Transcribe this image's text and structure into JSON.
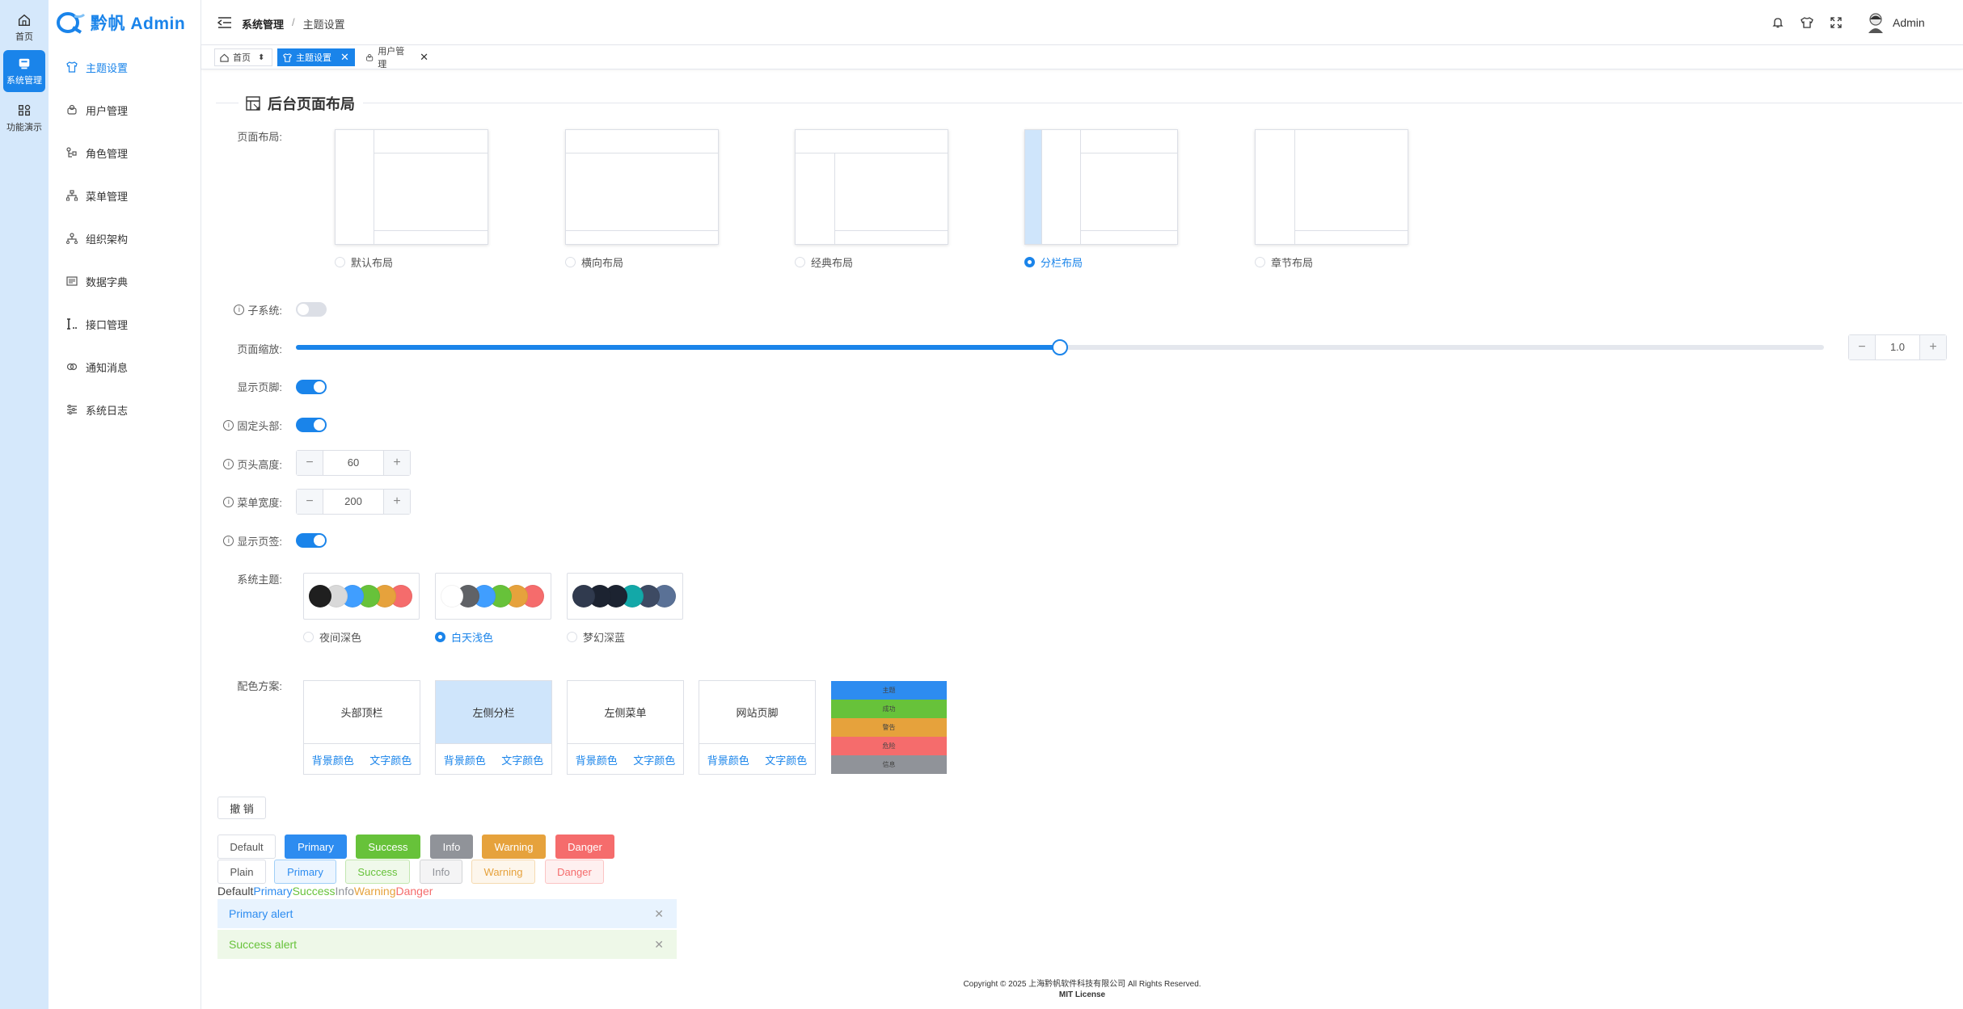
{
  "rail": {
    "items": [
      {
        "label": "首页",
        "icon": "home-icon"
      },
      {
        "label": "系统管理",
        "icon": "system-icon",
        "active": true
      },
      {
        "label": "功能演示",
        "icon": "grid-icon"
      }
    ]
  },
  "sidebar": {
    "logo": "黔帆 Admin",
    "items": [
      {
        "label": "主题设置",
        "icon": "shirt-icon",
        "active": true
      },
      {
        "label": "用户管理",
        "icon": "user-icon"
      },
      {
        "label": "角色管理",
        "icon": "role-icon"
      },
      {
        "label": "菜单管理",
        "icon": "menu-icon"
      },
      {
        "label": "组织架构",
        "icon": "org-icon"
      },
      {
        "label": "数据字典",
        "icon": "dict-icon"
      },
      {
        "label": "接口管理",
        "icon": "api-icon"
      },
      {
        "label": "通知消息",
        "icon": "notice-icon"
      },
      {
        "label": "系统日志",
        "icon": "log-icon"
      }
    ]
  },
  "header": {
    "breadcrumb": [
      "系统管理",
      "主题设置"
    ],
    "separator": "/",
    "user": "Admin"
  },
  "tabs": [
    {
      "label": "首页",
      "icon": "home-icon",
      "pinned": true
    },
    {
      "label": "主题设置",
      "icon": "shirt-icon",
      "active": true,
      "closable": true
    },
    {
      "label": "用户管理",
      "icon": "user-icon",
      "closable": true
    }
  ],
  "section": {
    "title": "后台页面布局"
  },
  "layout": {
    "label": "页面布局:",
    "options": [
      "默认布局",
      "横向布局",
      "经典布局",
      "分栏布局",
      "章节布局"
    ],
    "selected": 3
  },
  "settings": {
    "subsystem_label": "子系统:",
    "subsystem_on": false,
    "zoom_label": "页面缩放:",
    "zoom_value": "1.0",
    "zoom_fraction": 0.5,
    "footer_label": "显示页脚:",
    "footer_on": true,
    "fixed_header_label": "固定头部:",
    "fixed_header_on": true,
    "header_height_label": "页头高度:",
    "header_height": "60",
    "menu_width_label": "菜单宽度:",
    "menu_width": "200",
    "show_tabs_label": "显示页签:",
    "show_tabs_on": true
  },
  "theme": {
    "label": "系统主题:",
    "options": [
      {
        "name": "夜间深色",
        "colors": [
          "#1f1f1f",
          "#d9d9d9",
          "#409eff",
          "#67c23a",
          "#e6a23c",
          "#f56c6c"
        ]
      },
      {
        "name": "白天浅色",
        "colors": [
          "#ffffff",
          "#606266",
          "#409eff",
          "#67c23a",
          "#e6a23c",
          "#f56c6c"
        ],
        "selected": true
      },
      {
        "name": "梦幻深蓝",
        "colors": [
          "#303a4e",
          "#1c2331",
          "#1c2331",
          "#13a8a8",
          "#3d4a63",
          "#5a7196"
        ]
      }
    ]
  },
  "scheme": {
    "label": "配色方案:",
    "cards": [
      "头部顶栏",
      "左侧分栏",
      "左侧菜单",
      "网站页脚"
    ],
    "bg_color": "背景颜色",
    "text_color": "文字颜色",
    "palette": [
      {
        "label": "主题",
        "color": "#2d8cf0"
      },
      {
        "label": "成功",
        "color": "#67c23a"
      },
      {
        "label": "警告",
        "color": "#e6a23c"
      },
      {
        "label": "危险",
        "color": "#f56c6c"
      },
      {
        "label": "信息",
        "color": "#909399"
      }
    ]
  },
  "undo": "撤 销",
  "buttons_solid": [
    "Default",
    "Primary",
    "Success",
    "Info",
    "Warning",
    "Danger"
  ],
  "buttons_plain": [
    "Plain",
    "Primary",
    "Success",
    "Info",
    "Warning",
    "Danger"
  ],
  "text_colors": [
    "Default",
    "Primary",
    "Success",
    "Info",
    "Warning",
    "Danger"
  ],
  "alerts": {
    "primary": "Primary alert",
    "success": "Success alert"
  },
  "footer": {
    "copyright": "Copyright © 2025 上海黔帆软件科技有限公司 All Rights Reserved.",
    "license": "MIT License"
  }
}
